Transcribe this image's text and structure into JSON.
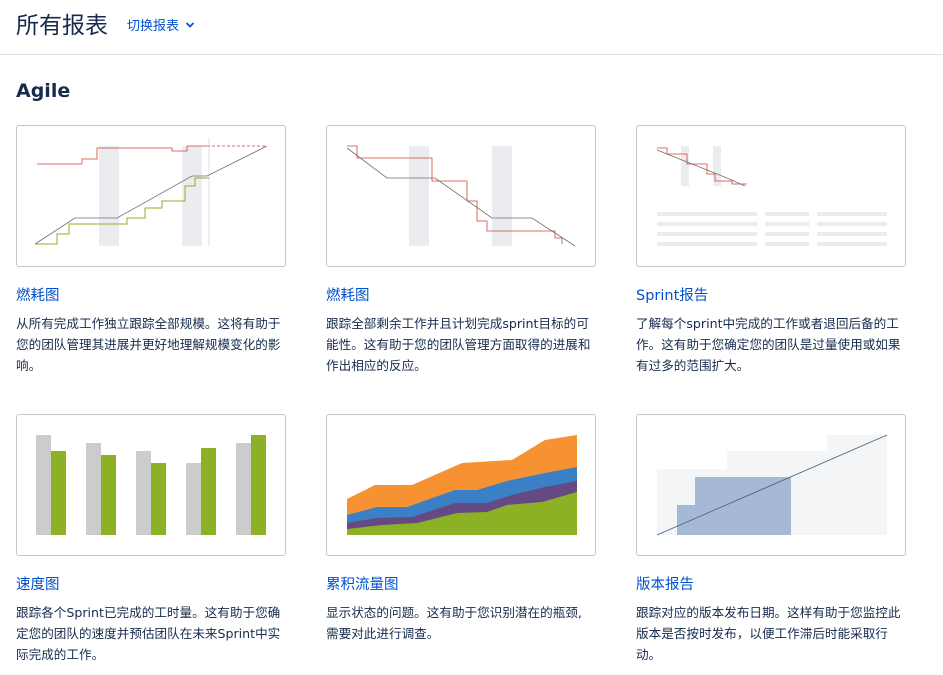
{
  "header": {
    "title": "所有报表",
    "switch_label": "切换报表",
    "switch_icon": "chevron-down-icon"
  },
  "section": {
    "title": "Agile"
  },
  "colors": {
    "link": "#0052cc",
    "text": "#172b4d",
    "border": "#c1c7d0",
    "green": "#8cb125",
    "orange": "#f79232",
    "blue": "#3b7fc4",
    "purple": "#654982"
  },
  "reports": [
    {
      "title": "燃耗图",
      "description": "从所有完成工作独立跟踪全部规模。这将有助于您的团队管理其进展并更好地理解规模变化的影响。"
    },
    {
      "title": "燃耗图",
      "description": "跟踪全部剩余工作并且计划完成sprint目标的可能性。这有助于您的团队管理方面取得的进展和作出相应的反应。"
    },
    {
      "title": "Sprint报告",
      "description": "了解每个sprint中完成的工作或者退回后备的工作。这有助于您确定您的团队是过量使用或如果有过多的范围扩大。"
    },
    {
      "title": "速度图",
      "description": "跟踪各个Sprint已完成的工时量。这有助于您确定您的团队的速度并预估团队在未来Sprint中实际完成的工作。"
    },
    {
      "title": "累积流量图",
      "description": "显示状态的问题。这有助于您识别潜在的瓶颈, 需要对此进行调查。"
    },
    {
      "title": "版本报告",
      "description": "跟踪对应的版本发布日期。这样有助于您监控此版本是否按时发布，以便工作滞后时能采取行动。"
    }
  ]
}
